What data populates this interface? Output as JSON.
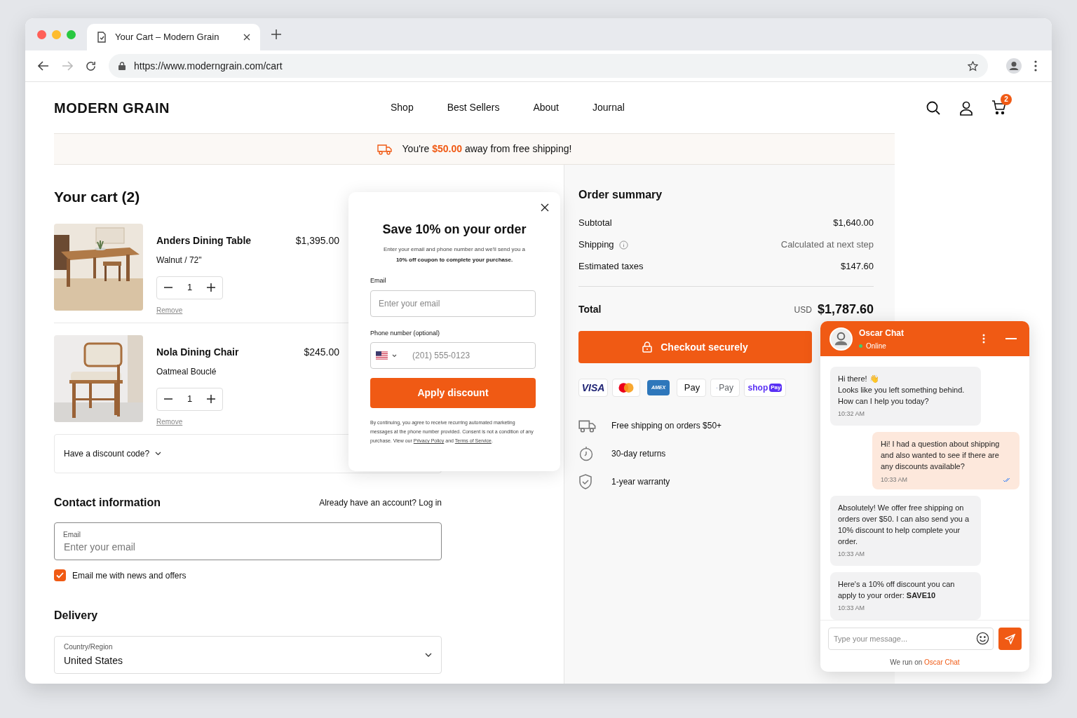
{
  "browser": {
    "tab_title": "Your Cart – Modern Grain",
    "url": "https://www.moderngrain.com/cart"
  },
  "header": {
    "logo": "MODERN GRAIN",
    "nav": [
      "Shop",
      "Best Sellers",
      "About",
      "Journal"
    ],
    "cart_count": "2"
  },
  "banner": "You're **$50.00** away from free shipping!",
  "cart": {
    "title": "Your cart (2)",
    "items": [
      {
        "name": "Anders Dining Table",
        "variant": "Walnut / 72\"",
        "price": "$1,395.00",
        "quantity": "1",
        "remove": "Remove"
      },
      {
        "name": "Nola Dining Chair",
        "variant": "Oatmeal Bouclé",
        "price": "$245.00",
        "quantity": "1",
        "remove": "Remove"
      }
    ],
    "discount_toggle": "Have a discount code?"
  },
  "contact": {
    "title": "Contact information",
    "login_prompt": "Already have an account? Log in",
    "email_label": "Email",
    "email_placeholder": "Enter your email",
    "newsletter": {
      "label": "Email me with news and offers",
      "checked": true
    }
  },
  "delivery": {
    "title": "Delivery",
    "country_label": "Country/Region",
    "country_value": "United States"
  },
  "summary": {
    "title": "Order summary",
    "rows": [
      {
        "label": "Subtotal",
        "value": "$1,640.00",
        "info": false
      },
      {
        "label": "Shipping",
        "value": "Calculated at next step",
        "info": true
      },
      {
        "label": "Estimated taxes",
        "value": "$147.60",
        "info": false
      }
    ],
    "total_label": "Total",
    "currency": "USD",
    "total": "$1,787.60",
    "checkout": "Checkout securely",
    "payment_methods": [
      {
        "kind": "visa",
        "label": "VISA"
      },
      {
        "kind": "mastercard"
      },
      {
        "kind": "amex",
        "label": "AMEX"
      },
      {
        "kind": "applepay",
        "label": "Pay"
      },
      {
        "kind": "gpay",
        "label": "Pay"
      },
      {
        "kind": "shoppay",
        "label": "shop",
        "badge": "Pay"
      }
    ],
    "features": [
      {
        "kind": "shipping",
        "text": "Free shipping on orders $50+"
      },
      {
        "kind": "returns",
        "text": "30-day returns"
      },
      {
        "kind": "warranty",
        "text": "1-year warranty"
      }
    ]
  },
  "popup": {
    "title": "Save 10% on your order",
    "subtitle": "Enter your email and phone number and we'll send you a",
    "subtitle_bold": "10% off coupon to complete your purchase.",
    "email_label": "Email",
    "email_placeholder": "Enter your email",
    "phone_label": "Phone number (optional)",
    "phone_placeholder": "(201) 555-0123",
    "button": "Apply discount",
    "legal": "By continuing, you agree to receive recurring automated marketing messages at the phone number provided. Consent is not a condition of any purchase. View our",
    "privacy_link": "Privacy Policy",
    "legal_and": "and",
    "terms_link": "Terms of Service",
    "legal_end": "."
  },
  "chat": {
    "name": "Oscar Chat",
    "status": "Online",
    "messages": [
      {
        "kind": "agent",
        "text": "Hi there! 👋\nLooks like you left something behind.\nHow can I help you today?",
        "time": "10:32 AM"
      },
      {
        "kind": "user",
        "text": "Hi! I had a question about shipping and also wanted to see if there are any discounts available?",
        "time": "10:33 AM",
        "read": true
      },
      {
        "kind": "agent",
        "text": "Absolutely! We offer free shipping on orders over $50. I can also send you a 10% discount to help complete your order.",
        "time": "10:33 AM"
      },
      {
        "kind": "agent",
        "text": "Here's a 10% off discount you can apply to your order:   **SAVE10**",
        "time": "10:33 AM"
      }
    ],
    "input_placeholder": "Type your message...",
    "footer": "We run on",
    "footer_link": "Oscar Chat"
  }
}
